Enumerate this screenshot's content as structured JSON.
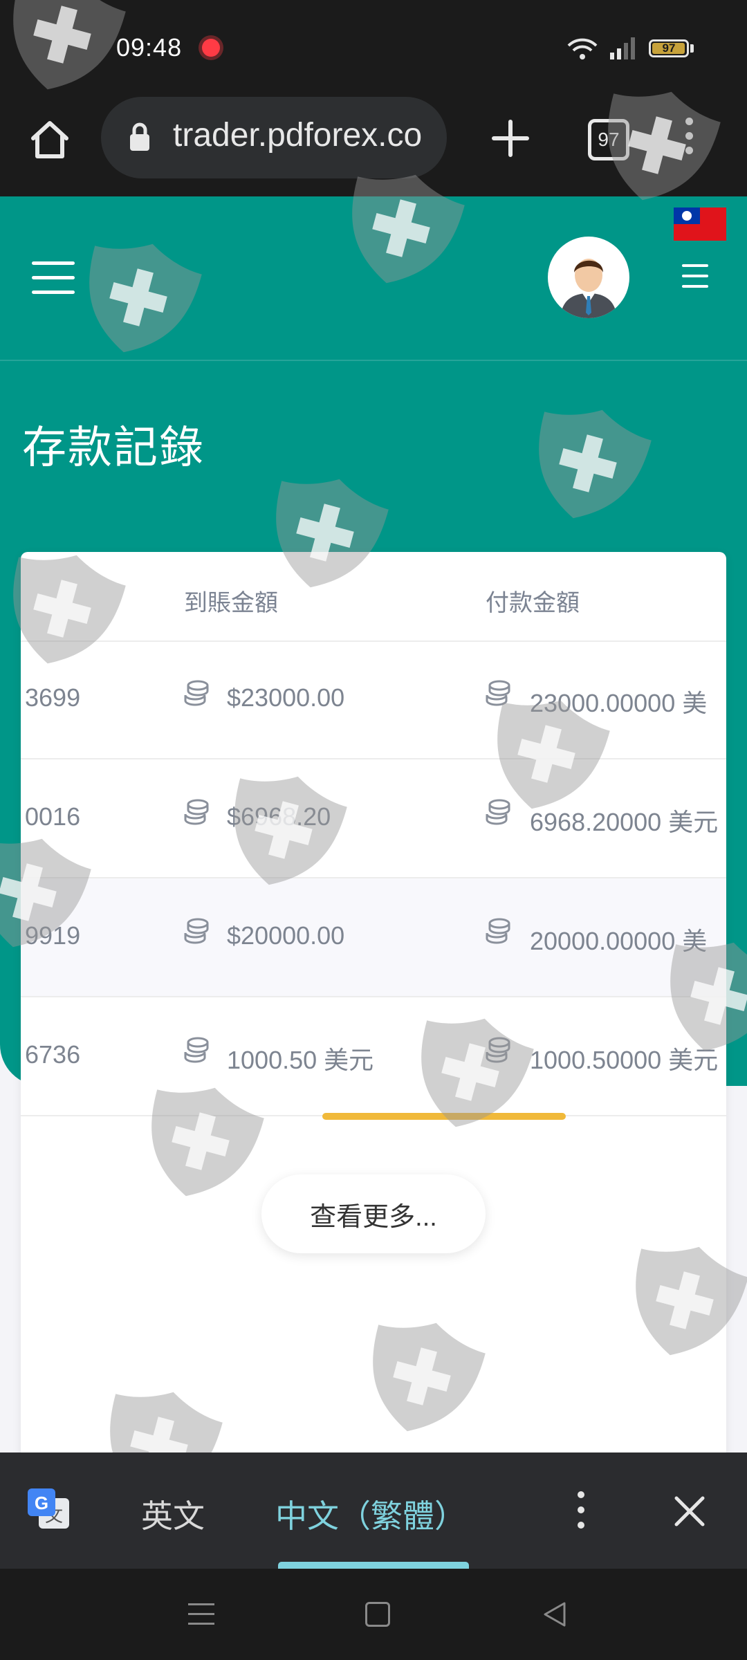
{
  "status_bar": {
    "time": "09:48",
    "battery": "97",
    "battery_level": 0.97
  },
  "browser": {
    "url": "trader.pdforex.co",
    "tab_count": "97",
    "icons": [
      "home-icon",
      "lock-icon",
      "plus-icon",
      "tab-switcher-icon",
      "more-vert-icon"
    ]
  },
  "header": {
    "flag": "taiwan-flag",
    "page_title": "存款記錄"
  },
  "table": {
    "columns": [
      "到賬金額",
      "付款金額"
    ],
    "rows": [
      {
        "id": "3699",
        "received": "$23000.00",
        "paid": "23000.00000 美"
      },
      {
        "id": "0016",
        "received": "$6968.20",
        "paid": "6968.20000 美元"
      },
      {
        "id": "9919",
        "received": "$20000.00",
        "paid": "20000.00000 美"
      },
      {
        "id": "6736",
        "received": "1000.50 美元",
        "paid": "1000.50000 美元"
      }
    ],
    "more_label": "查看更多..."
  },
  "translate_bar": {
    "source_lang": "英文",
    "target_lang": "中文（繁體）",
    "icons": [
      "google-translate-icon",
      "more-vert-icon",
      "close-icon"
    ]
  },
  "colors": {
    "teal": "#009688",
    "accent_yellow": "#f0b93a",
    "translate_active": "#7fd2de"
  }
}
